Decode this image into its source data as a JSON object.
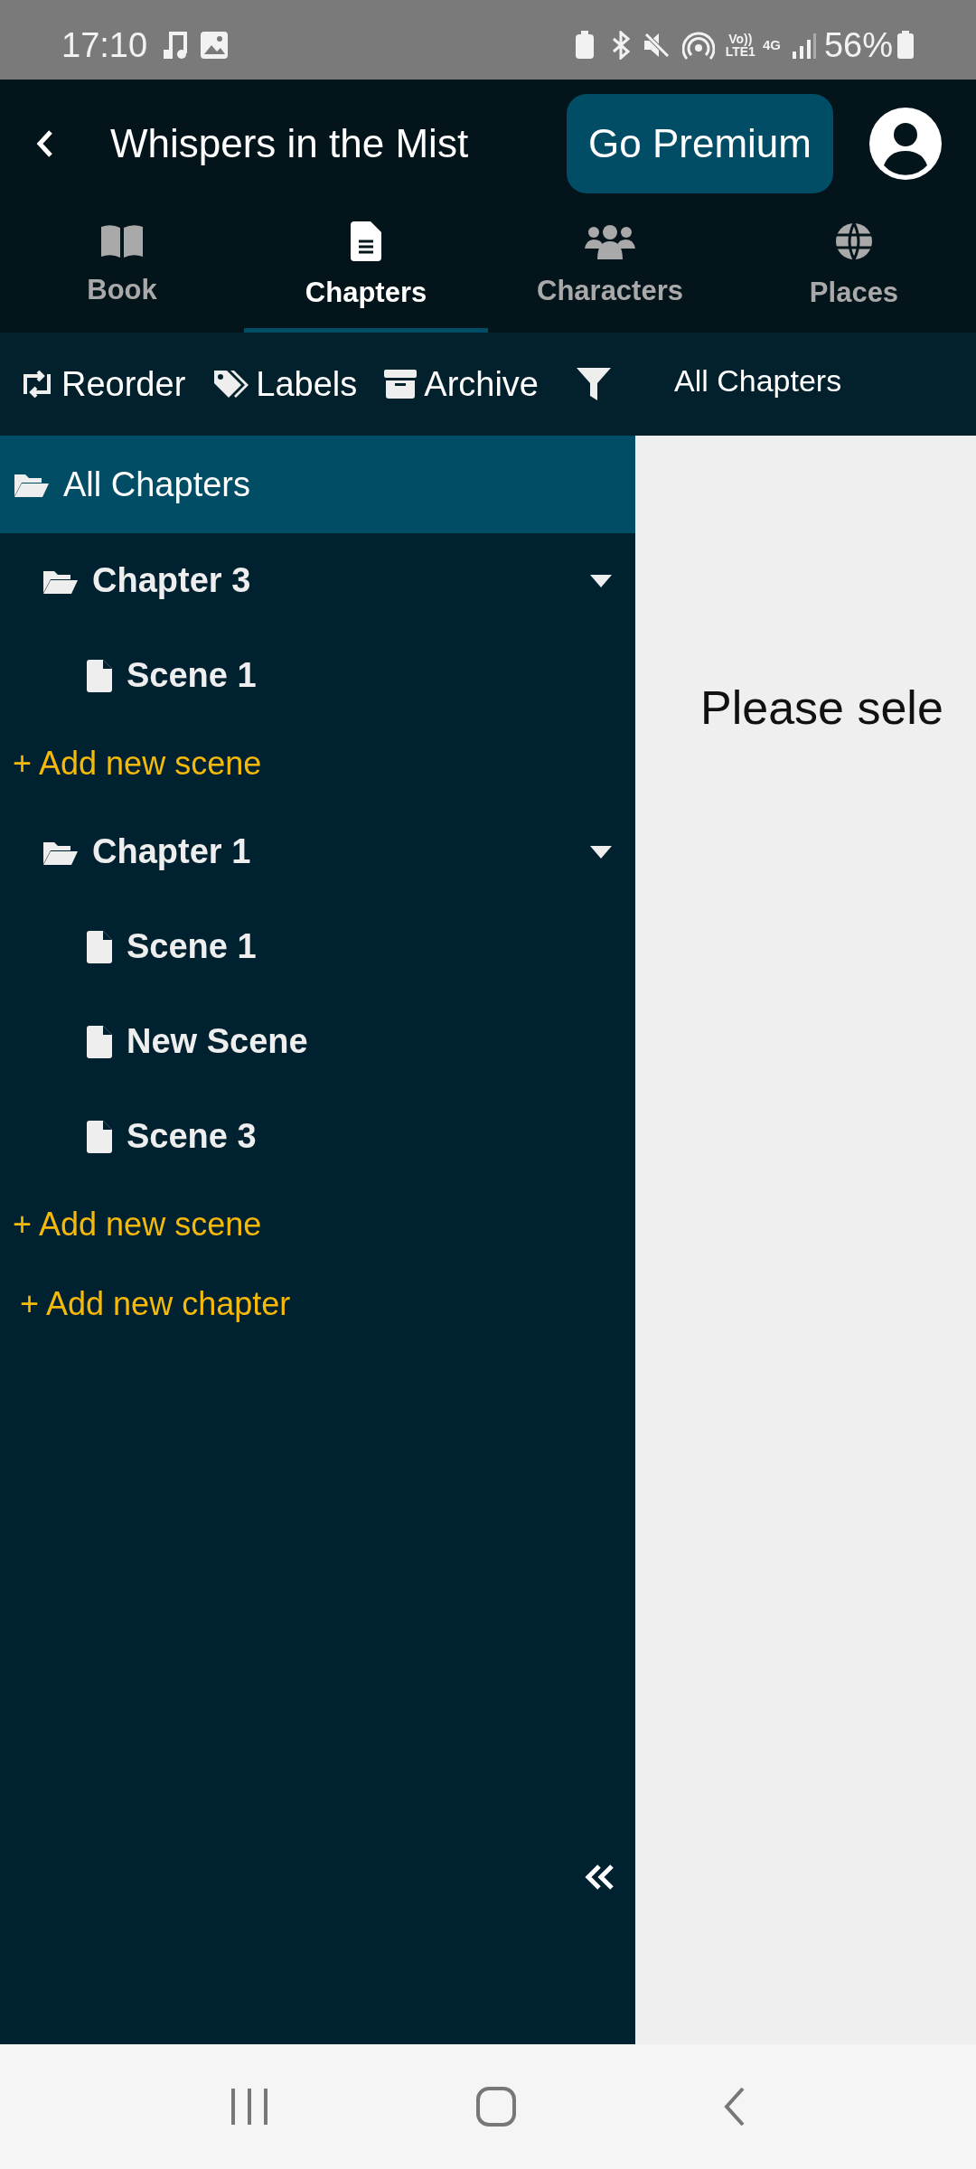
{
  "status_bar": {
    "time": "17:10",
    "volte": "Vo))",
    "lte": "LTE1",
    "network": "4G",
    "battery": "56%"
  },
  "header": {
    "title": "Whispers in the Mist",
    "premium_button": "Go Premium"
  },
  "tabs": [
    {
      "kind": "book",
      "label": "Book",
      "selected": false
    },
    {
      "kind": "chapters",
      "label": "Chapters",
      "selected": true
    },
    {
      "kind": "characters",
      "label": "Characters",
      "selected": false
    },
    {
      "kind": "places",
      "label": "Places",
      "selected": false
    }
  ],
  "toolbar": {
    "items": [
      {
        "kind": "reorder",
        "label": "Reorder"
      },
      {
        "kind": "labels",
        "label": "Labels"
      },
      {
        "kind": "archive",
        "label": "Archive"
      }
    ],
    "filter_value": "All Chapters"
  },
  "sidebar": {
    "all_item": {
      "label": "All Chapters",
      "selected": true
    },
    "chapters": [
      {
        "label": "Chapter 3",
        "expanded": true,
        "children": [
          {
            "label": "Scene 1",
            "selected": false
          }
        ],
        "add_scene": "+ Add new scene"
      },
      {
        "label": "Chapter 1",
        "expanded": true,
        "children": [
          {
            "label": "Scene 1",
            "selected": false
          },
          {
            "label": "New Scene",
            "selected": false
          },
          {
            "label": "Scene 3",
            "selected": false
          }
        ],
        "add_scene": "+ Add new scene"
      }
    ],
    "add_chapter": "+ Add new chapter"
  },
  "content": {
    "message": "Please sele"
  }
}
